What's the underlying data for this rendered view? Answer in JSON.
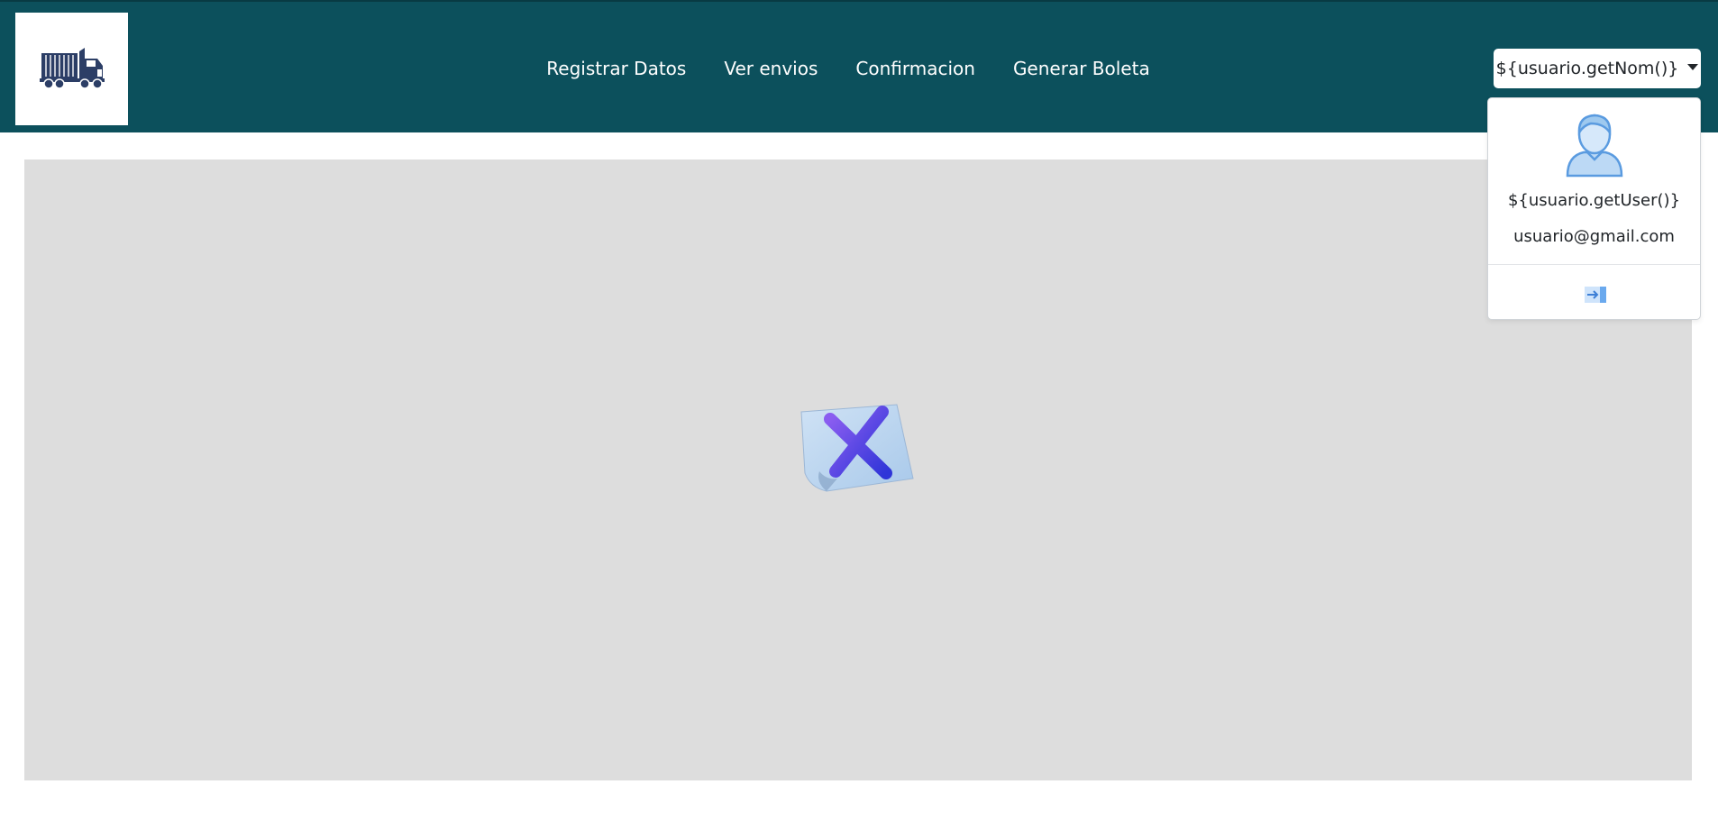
{
  "header": {
    "nav": [
      {
        "label": "Registrar Datos"
      },
      {
        "label": "Ver envios"
      },
      {
        "label": "Confirmacion"
      },
      {
        "label": "Generar Boleta"
      }
    ],
    "user_button_label": "${usuario.getNom()}",
    "logo_icon": "truck-icon"
  },
  "user_menu": {
    "avatar_icon": "user-avatar-icon",
    "user": "${usuario.getUser()}",
    "email": "usuario@gmail.com",
    "logout_icon": "logout-icon"
  },
  "main": {
    "image_icon": "broken-image-icon",
    "background": "#dddddd"
  },
  "colors": {
    "header_bg": "#0c505c",
    "accent_avatar": "#9ec9ef",
    "avatar_stroke": "#5a9be0"
  }
}
